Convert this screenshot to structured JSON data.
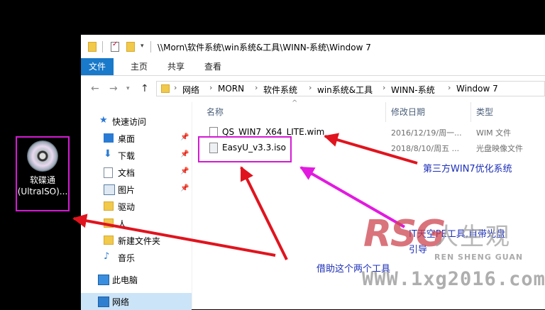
{
  "desktop_icon": {
    "label_line1": "软碟通",
    "label_line2": "(UltraISO)...",
    "icon": "disc-icon"
  },
  "window": {
    "title_path": "\\\\Morn\\软件系统\\win系统&工具\\WINN-系统\\Window 7",
    "ribbon_tabs": [
      "文件",
      "主页",
      "共享",
      "查看"
    ],
    "breadcrumbs": [
      "网络",
      "MORN",
      "软件系统",
      "win系统&工具",
      "WINN-系统",
      "Window 7"
    ],
    "nav": {
      "quick_access": "快速访问",
      "items": [
        {
          "label": "桌面",
          "icon": "desktop-icon",
          "pinned": true
        },
        {
          "label": "下载",
          "icon": "download-icon",
          "pinned": true
        },
        {
          "label": "文档",
          "icon": "documents-icon",
          "pinned": true
        },
        {
          "label": "图片",
          "icon": "pictures-icon",
          "pinned": true
        },
        {
          "label": "驱动",
          "icon": "folder-icon",
          "pinned": false
        },
        {
          "label": "人",
          "icon": "folder-icon",
          "pinned": false
        },
        {
          "label": "新建文件夹",
          "icon": "folder-icon",
          "pinned": false
        },
        {
          "label": "音乐",
          "icon": "music-icon",
          "pinned": false
        }
      ],
      "this_pc": "此电脑",
      "network": "网络"
    },
    "columns": {
      "name": "名称",
      "date": "修改日期",
      "type": "类型"
    },
    "files": [
      {
        "name": "QS_WIN7_X64_LITE.wim",
        "date": "2016/12/19/周一...",
        "type": "WIM 文件"
      },
      {
        "name": "EasyU_v3.3.iso",
        "date": "2018/8/10/周五 ...",
        "type": "光盘映像文件"
      }
    ]
  },
  "annotations": {
    "wim_note": "第三方WIN7优化系统",
    "iso_note_line1": "IT天空PE工具,自带光盘",
    "iso_note_line2": "引导",
    "tools_note": "借助这个两个工具"
  },
  "watermark": {
    "logo": "RSG",
    "cn": "人生观",
    "en": "REN SHENG GUAN",
    "url": "WWW.1xg2016.com"
  },
  "colors": {
    "accent": "#1979ca",
    "highlight": "#d41ad4",
    "arrow_red": "#e0141e",
    "arrow_magenta": "#e21ae0",
    "note_blue": "#1c2fb8"
  }
}
